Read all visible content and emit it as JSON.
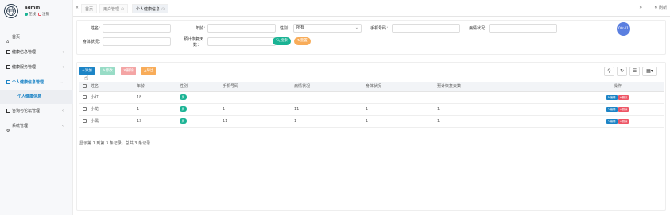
{
  "user": {
    "name": "admin",
    "online": "在线",
    "logout": "注销"
  },
  "nav": {
    "home": "首页",
    "health_info_mgmt": "健康信息管理",
    "health_service_mgmt": "健康服务管理",
    "personal_health_mgmt": "个人健康信息管理",
    "personal_health_info": "个人健康信息",
    "consult_mgmt": "咨询与论坛管理",
    "system_mgmt": "系统管理"
  },
  "tabs": {
    "home": "首页",
    "user_mgmt": "用户管理",
    "personal_info": "个人健康信息",
    "refresh": "刷新"
  },
  "search": {
    "name_label": "姓名：",
    "age_label": "年龄：",
    "gender_label": "性别：",
    "gender_value": "所有",
    "phone_label": "手机号码：",
    "disease_label": "病情状况：",
    "body_label": "身体状况：",
    "recovery_label_1": "预计恢复天",
    "recovery_label_2": "数：",
    "search_btn": "搜索",
    "reset_btn": "重置",
    "clock": "00:41"
  },
  "toolbar": {
    "add": "添加",
    "edit": "修改",
    "delete": "删除",
    "export": "导出"
  },
  "table": {
    "headers": [
      "姓名",
      "年龄",
      "性别",
      "手机号码",
      "病情状况",
      "身体状况",
      "预计恢复天数",
      "操作"
    ],
    "rows": [
      {
        "name": "小红",
        "age": "18",
        "gender": "男",
        "phone": "",
        "disease": "",
        "body": "",
        "recovery": ""
      },
      {
        "name": "小龙",
        "age": "1",
        "gender": "男",
        "phone": "1",
        "disease": "11",
        "body": "1",
        "recovery": "1"
      },
      {
        "name": "小黑",
        "age": "13",
        "gender": "男",
        "phone": "11",
        "disease": "1",
        "body": "1",
        "recovery": "1"
      }
    ],
    "edit_label": "编辑",
    "delete_label": "删除",
    "footer": "显示第 1 到第 3 条记录，总共 3 条记录"
  },
  "colors": {
    "primary": "#1c84c6",
    "success": "#1ab394",
    "warning": "#f8ac59",
    "danger": "#ed5565"
  }
}
